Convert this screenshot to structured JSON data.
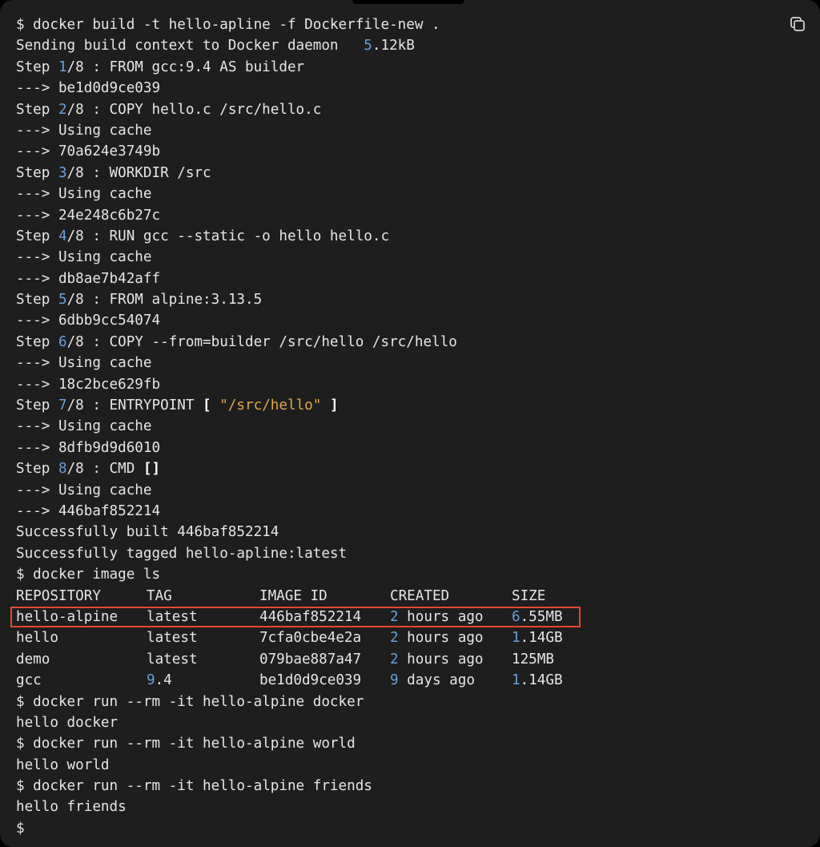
{
  "copy_icon": "copy-icon",
  "colors": {
    "background": "#1e1e1e",
    "text": "#e6e6e6",
    "number": "#6a9fdc",
    "string": "#e3a64a",
    "highlight": "#e2492f"
  },
  "build": {
    "command": "$ docker build -t hello-apline -f Dockerfile-new .",
    "context_prefix": "Sending build context to Docker daemon   ",
    "context_num": "5",
    "context_rest": ".12kB",
    "steps": [
      {
        "num": "1",
        "rest": "/8 : FROM gcc:9.4 AS builder",
        "lines": [
          "---> be1d0d9ce039"
        ]
      },
      {
        "num": "2",
        "rest": "/8 : COPY hello.c /src/hello.c",
        "lines": [
          "---> Using cache",
          "---> 70a624e3749b"
        ]
      },
      {
        "num": "3",
        "rest": "/8 : WORKDIR /src",
        "lines": [
          "---> Using cache",
          "---> 24e248c6b27c"
        ]
      },
      {
        "num": "4",
        "rest": "/8 : RUN gcc --static -o hello hello.c",
        "lines": [
          "---> Using cache",
          "---> db8ae7b42aff"
        ]
      },
      {
        "num": "5",
        "rest": "/8 : FROM alpine:3.13.5",
        "lines": [
          "---> 6dbb9cc54074"
        ]
      },
      {
        "num": "6",
        "rest": "/8 : COPY --from=builder /src/hello /src/hello",
        "lines": [
          "---> Using cache",
          "---> 18c2bce629fb"
        ]
      },
      {
        "num": "7",
        "rest": "/8 : ENTRYPOINT ",
        "bracket_open": "[",
        "string": " \"/src/hello\" ",
        "bracket_close": "]",
        "lines": [
          "---> Using cache",
          "---> 8dfb9d9d6010"
        ]
      },
      {
        "num": "8",
        "rest": "/8 : CMD ",
        "bracket_open": "[]",
        "lines": [
          "---> Using cache",
          "---> 446baf852214"
        ]
      }
    ],
    "success_built": "Successfully built 446baf852214",
    "success_tagged": "Successfully tagged hello-apline:latest"
  },
  "image_ls": {
    "command": "$ docker image ls",
    "headers": [
      "REPOSITORY",
      "TAG",
      "IMAGE ID",
      "CREATED",
      "SIZE"
    ],
    "rows": [
      {
        "repo": "hello-alpine",
        "tag_num": "",
        "tag": "latest",
        "id": "446baf852214",
        "created_num": "2",
        "created": " hours ago",
        "size_num": "6",
        "size": ".55MB",
        "highlighted": true
      },
      {
        "repo": "hello",
        "tag_num": "",
        "tag": "latest",
        "id": "7cfa0cbe4e2a",
        "created_num": "2",
        "created": " hours ago",
        "size_num": "1",
        "size": ".14GB"
      },
      {
        "repo": "demo",
        "tag_num": "",
        "tag": "latest",
        "id": "079bae887a47",
        "created_num": "2",
        "created": " hours ago",
        "size_num": "",
        "size": "125MB"
      },
      {
        "repo": "gcc",
        "tag_num": "9",
        "tag": ".4",
        "id": "be1d0d9ce039",
        "created_num": "9",
        "created": " days ago",
        "size_num": "1",
        "size": ".14GB"
      }
    ]
  },
  "runs": [
    {
      "command": "$ docker run --rm -it hello-alpine docker",
      "output": "hello docker"
    },
    {
      "command": "$ docker run --rm -it hello-alpine world",
      "output": "hello world"
    },
    {
      "command": "$ docker run --rm -it hello-alpine friends",
      "output": "hello friends"
    }
  ],
  "prompt": "$"
}
